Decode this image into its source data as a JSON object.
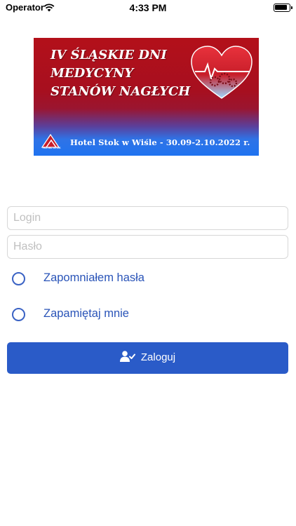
{
  "status_bar": {
    "carrier": "Operator",
    "time": "4:33 PM"
  },
  "banner": {
    "title_lines": [
      "IV ŚLĄSKIE DNI",
      "MEDYCYNY",
      "STANÓW NAGŁYCH"
    ],
    "subtitle": "Hotel Stok w Wiśle - 30.09-2.10.2022 r.",
    "logo_text": "HOTEL STOK",
    "colors": {
      "top": "#b3101a",
      "bottom": "#1f73f0"
    }
  },
  "form": {
    "login_placeholder": "Login",
    "password_placeholder": "Hasło",
    "forgot_password_label": "Zapomniałem hasła",
    "remember_me_label": "Zapamiętaj mnie",
    "submit_label": "Zaloguj"
  },
  "theme": {
    "accent": "#2a5bc8",
    "link": "#2a54b8"
  },
  "icons": {
    "wifi": "wifi-icon",
    "battery": "battery-icon",
    "user_check": "user-check-icon"
  }
}
